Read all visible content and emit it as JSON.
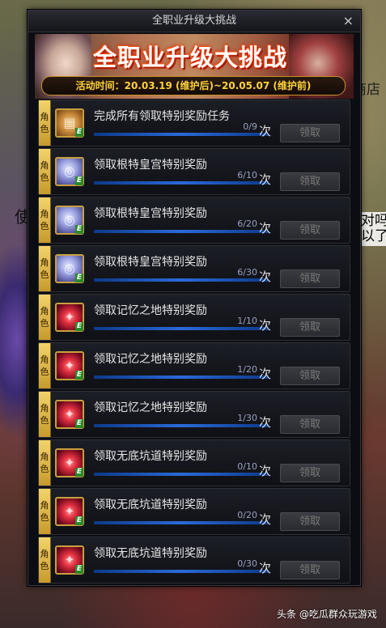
{
  "window": {
    "title": "全职业升级大挑战",
    "close_label": "×"
  },
  "banner": {
    "title": "全职业升级大挑战",
    "date": "活动时间：20.03.19 (维护后)~20.05.07 (维护前)"
  },
  "background": {
    "left_text": "使",
    "right_text": "对吗以了",
    "shop_text": "商店"
  },
  "tag_label": [
    "角",
    "色"
  ],
  "times_label": "次",
  "claim_label": "领取",
  "tasks": [
    {
      "text": "完成所有领取特别奖励任务",
      "progress": "0/9",
      "icon": "scroll-icon"
    },
    {
      "text": "领取根特皇宫特别奖励",
      "progress": "6/10",
      "icon": "coin-icon"
    },
    {
      "text": "领取根特皇宫特别奖励",
      "progress": "6/20",
      "icon": "coin-icon"
    },
    {
      "text": "领取根特皇宫特别奖励",
      "progress": "6/30",
      "icon": "coin-icon"
    },
    {
      "text": "领取记忆之地特别奖励",
      "progress": "1/10",
      "icon": "crystal-icon"
    },
    {
      "text": "领取记忆之地特别奖励",
      "progress": "1/20",
      "icon": "crystal-icon"
    },
    {
      "text": "领取记忆之地特别奖励",
      "progress": "1/30",
      "icon": "crystal-icon"
    },
    {
      "text": "领取无底坑道特别奖励",
      "progress": "0/10",
      "icon": "crystal-icon"
    },
    {
      "text": "领取无底坑道特别奖励",
      "progress": "0/20",
      "icon": "crystal-icon"
    },
    {
      "text": "领取无底坑道特别奖励",
      "progress": "0/30",
      "icon": "crystal-icon"
    }
  ],
  "watermark": "头条 @吃瓜群众玩游戏"
}
